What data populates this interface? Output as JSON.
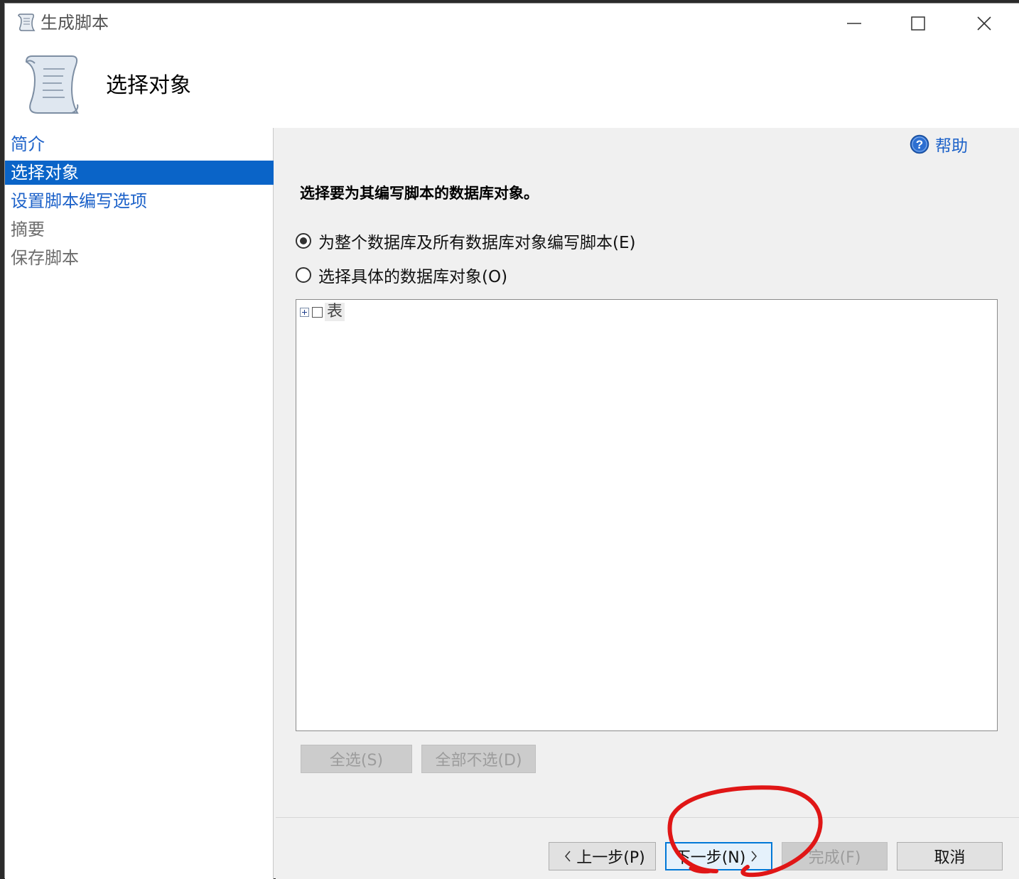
{
  "window": {
    "title": "生成脚本",
    "minimize_icon": "minimize-icon",
    "maximize_icon": "maximize-icon",
    "close_icon": "close-icon"
  },
  "header": {
    "icon": "script-scroll-icon",
    "title": "选择对象"
  },
  "sidebar": {
    "items": [
      {
        "label": "简介",
        "state": "link"
      },
      {
        "label": "选择对象",
        "state": "active"
      },
      {
        "label": "设置脚本编写选项",
        "state": "link"
      },
      {
        "label": "摘要",
        "state": "disabled"
      },
      {
        "label": "保存脚本",
        "state": "disabled"
      }
    ]
  },
  "main": {
    "help_label": "帮助",
    "help_icon": "help-icon",
    "instruction": "选择要为其编写脚本的数据库对象。",
    "options": [
      {
        "label": "为整个数据库及所有数据库对象编写脚本(E)",
        "selected": true
      },
      {
        "label": "选择具体的数据库对象(O)",
        "selected": false
      }
    ],
    "tree": {
      "nodes": [
        {
          "label": "表",
          "expanded": false,
          "checked": false
        }
      ]
    },
    "select_all_label": "全选(S)",
    "deselect_all_label": "全部不选(D)"
  },
  "footer": {
    "previous_label": "上一步(P)",
    "next_label": "下一步(N)",
    "finish_label": "完成(F)",
    "cancel_label": "取消"
  },
  "colors": {
    "accent": "#0a64c8",
    "link": "#1d62c9",
    "annotation": "#e01616",
    "default_button_border": "#0078d7"
  }
}
